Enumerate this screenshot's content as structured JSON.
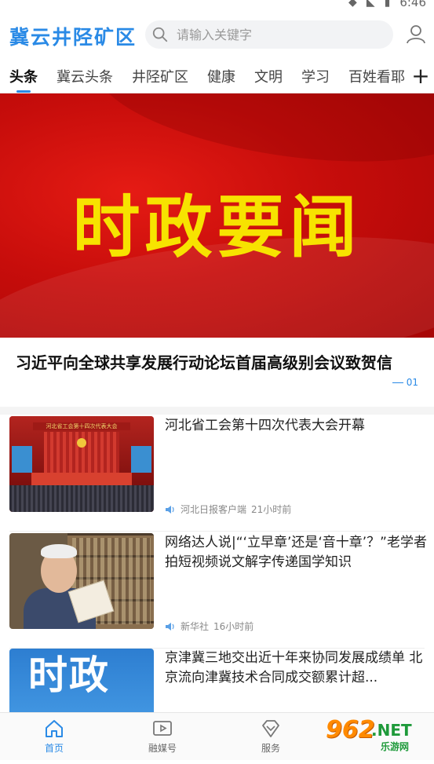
{
  "status_bar": {
    "time": "6:46"
  },
  "header": {
    "app_title": "冀云井陉矿区",
    "search_placeholder": "请输入关键字"
  },
  "tabs": [
    {
      "label": "头条",
      "active": true
    },
    {
      "label": "冀云头条"
    },
    {
      "label": "井陉矿区"
    },
    {
      "label": "健康"
    },
    {
      "label": "文明"
    },
    {
      "label": "学习"
    },
    {
      "label": "百姓看耶"
    }
  ],
  "tabs_add": "+",
  "banner": {
    "text": "时政要闻",
    "headline": "习近平向全球共享发展行动论坛首届高级别会议致贺信",
    "page": "01"
  },
  "news": [
    {
      "title": "河北省工会第十四次代表大会开幕",
      "source": "河北日报客户端",
      "time": "21小时前",
      "thumb_caption": "河北省工会第十四次代表大会"
    },
    {
      "title": "网络达人说|“‘立早章’还是‘音十章’？”老学者拍短视频说文解字传递国学知识",
      "source": "新华社",
      "time": "16小时前"
    },
    {
      "title": "京津冀三地交出近十年来协同发展成绩单 北京流向津冀技术合同成交额累计超...",
      "thumb_text": "时政"
    }
  ],
  "bottom_nav": [
    {
      "label": "首页",
      "icon": "home-icon",
      "active": true
    },
    {
      "label": "融媒号",
      "icon": "video-icon"
    },
    {
      "label": "服务",
      "icon": "diamond-icon"
    }
  ],
  "watermark": {
    "brand": "962",
    "suffix": ".NET",
    "sub": "乐游网"
  },
  "colors": {
    "accent": "#2a8ae6",
    "banner_red": "#c70d0b",
    "banner_text": "#f7e300"
  }
}
